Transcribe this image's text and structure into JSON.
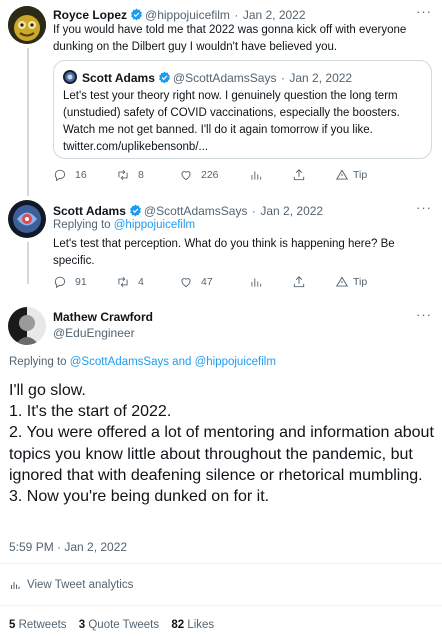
{
  "tweet1": {
    "author_name": "Royce Lopez",
    "handle": "@hippojuicefilm",
    "dot": "·",
    "date": "Jan 2, 2022",
    "text": "If you would have told me that 2022 was gonna kick off with everyone dunking on the Dilbert guy I wouldn't have believed you.",
    "quote": {
      "author_name": "Scott Adams",
      "handle": "@ScottAdamsSays",
      "dot": "·",
      "date": "Jan 2, 2022",
      "text": "Let's test your theory right now. I genuinely question the long term (unstudied) safety of COVID vaccinations, especially the boosters. Watch me not get banned. I'll do it again tomorrow if you like.",
      "link": "twitter.com/uplikebensonb/..."
    },
    "actions": {
      "replies": "16",
      "retweets": "8",
      "likes": "226",
      "tip": "Tip"
    }
  },
  "tweet2": {
    "author_name": "Scott Adams",
    "handle": "@ScottAdamsSays",
    "dot": "·",
    "date": "Jan 2, 2022",
    "replying_prefix": "Replying to",
    "replying_to": "@hippojuicefilm",
    "text": "Let's test that perception. What do you think is happening here? Be specific.",
    "actions": {
      "replies": "91",
      "retweets": "4",
      "likes": "47",
      "tip": "Tip"
    }
  },
  "main_tweet": {
    "author_name": "Mathew Crawford",
    "handle": "@EduEngineer",
    "replying_prefix": "Replying to",
    "replying_users": "@ScottAdamsSays and @hippojuicefilm",
    "lines": [
      "I'll go slow.",
      "1. It's the start of 2022.",
      "2. You were offered a lot of mentoring and information about topics you know little about throughout the pandemic, but ignored that with deafening silence or rhetorical mumbling.",
      "3. Now you're being dunked on for it."
    ],
    "timestamp": "5:59 PM · Jan 2, 2022",
    "analytics_label": "View Tweet analytics",
    "stats": {
      "retweets_count": "5",
      "retweets_label": "Retweets",
      "quotes_count": "3",
      "quotes_label": "Quote Tweets",
      "likes_count": "82",
      "likes_label": "Likes"
    }
  },
  "more_label": "···",
  "colors": {
    "accent": "#1d9bf0",
    "text": "#0f1419",
    "muted": "#536471",
    "border": "#cfd9de"
  }
}
